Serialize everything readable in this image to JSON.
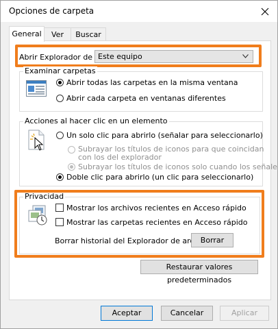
{
  "window": {
    "title": "Opciones de carpeta"
  },
  "tabs": [
    {
      "label": "General",
      "active": true
    },
    {
      "label": "Ver",
      "active": false
    },
    {
      "label": "Buscar",
      "active": false
    }
  ],
  "open_explorer": {
    "label": "Abrir Explorador de arch",
    "selected_value": "Este equipo"
  },
  "browse_folders": {
    "title": "Examinar carpetas",
    "options": [
      {
        "label": "Abrir todas las carpetas en la misma ventana",
        "selected": true
      },
      {
        "label": "Abrir cada carpeta en ventanas diferentes",
        "selected": false
      }
    ]
  },
  "click_actions": {
    "title": "Acciones al hacer clic en un elemento",
    "single_click": {
      "label": "Un solo clic para abrirlo (señalar para seleccionarlo)",
      "selected": false
    },
    "underline_browser_line1": "Subrayar los títulos de iconos para que coincidan",
    "underline_browser_line2": "con los del explorador",
    "underline_point": "Subrayar los títulos de iconos solo cuando los señale",
    "double_click": {
      "label": "Doble clic para abrirlo (un clic para seleccionarlo)",
      "selected": true
    }
  },
  "privacy": {
    "title": "Privacidad",
    "recent_files": "Mostrar los archivos recientes en Acceso rápido",
    "recent_folders": "Mostrar las carpetas recientes en Acceso rápido",
    "clear_history_label": "Borrar historial del Explorador de archivos",
    "clear_button": "Borrar"
  },
  "restore_defaults": "Restaurar valores predeterminados",
  "footer": {
    "accept": "Aceptar",
    "cancel": "Cancelar",
    "apply": "Aplicar"
  },
  "colors": {
    "highlight": "#f07d1c",
    "accent": "#0078d7"
  }
}
